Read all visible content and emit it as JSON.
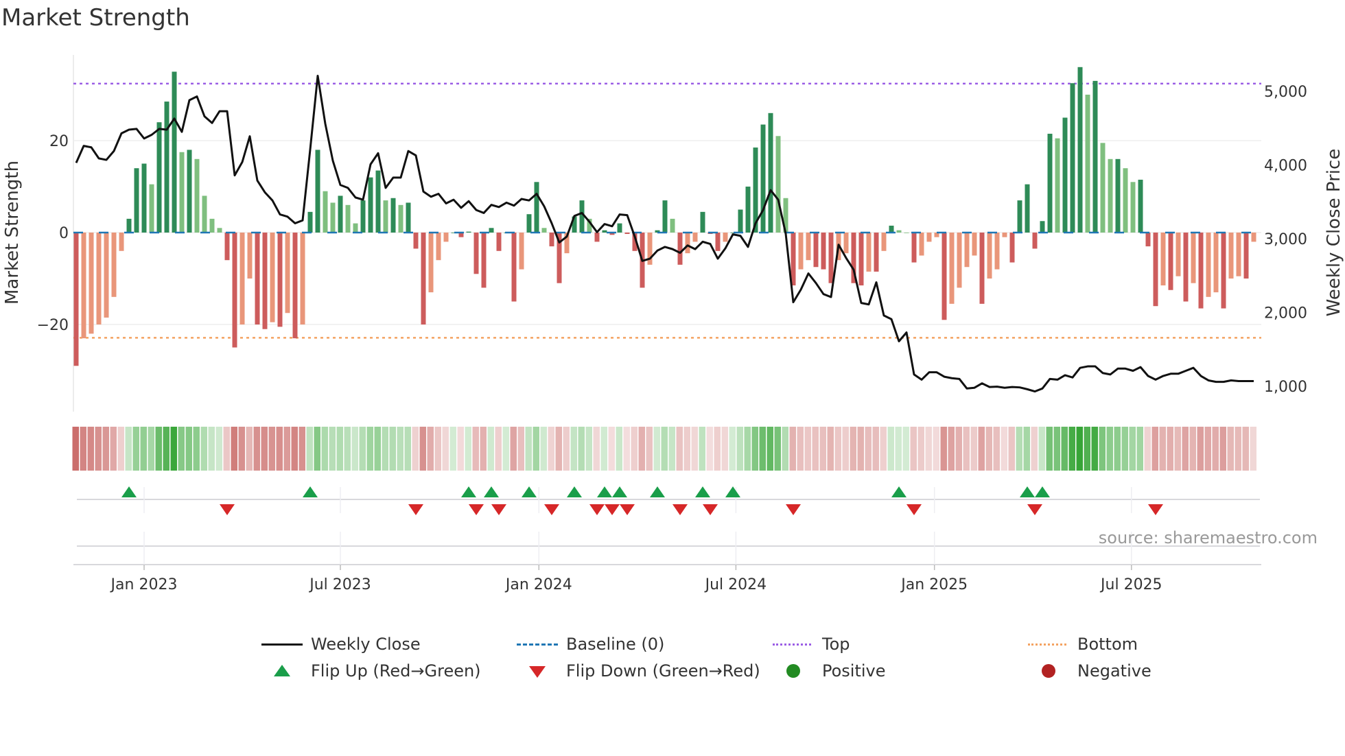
{
  "title": "Market Strength",
  "source": "source: sharemaestro.com",
  "chart_data": {
    "type": "bar",
    "title": "Market Strength",
    "ylabel": "Market Strength",
    "y2label": "Weekly Close Price",
    "ylim": [
      -38,
      38
    ],
    "y2lim": [
      770,
      5450
    ],
    "yticks": [
      {
        "v": 20,
        "label": "20"
      },
      {
        "v": 0,
        "label": "0"
      },
      {
        "v": -20,
        "label": "−20"
      }
    ],
    "y2ticks": [
      {
        "v": 5000,
        "label": "5,000"
      },
      {
        "v": 4000,
        "label": "4,000"
      },
      {
        "v": 3000,
        "label": "3,000"
      },
      {
        "v": 2000,
        "label": "2,000"
      },
      {
        "v": 1000,
        "label": "1,000"
      }
    ],
    "xticks": [
      {
        "week": 9,
        "label": "Jan 2023"
      },
      {
        "week": 35,
        "label": "Jul 2023"
      },
      {
        "week": 61.3,
        "label": "Jan 2024"
      },
      {
        "week": 87.4,
        "label": "Jul 2024"
      },
      {
        "week": 113.7,
        "label": "Jan 2025"
      },
      {
        "week": 139.8,
        "label": "Jul 2025"
      }
    ],
    "top_level": 32.4,
    "bottom_level": -22.9,
    "baseline": 0,
    "strength": [
      -29,
      -23,
      -22,
      -20,
      -18.5,
      -14,
      -4,
      3,
      14,
      15,
      10.5,
      24,
      28.5,
      35,
      17.5,
      18,
      16,
      8,
      3,
      1,
      -6,
      -25,
      -20,
      -10,
      -20,
      -21,
      -19.5,
      -20.5,
      -17.5,
      -23,
      -20,
      4.5,
      18,
      9,
      6.5,
      8,
      6,
      2,
      7,
      12,
      13.5,
      7,
      7.5,
      6,
      6.5,
      -3.5,
      -20,
      -13,
      -6,
      -2,
      0,
      -1,
      0.2,
      -9,
      -12,
      1,
      -4,
      0,
      -15,
      -8,
      4,
      11,
      1,
      -3,
      -11,
      -4.5,
      3.5,
      7,
      3,
      -2,
      0.5,
      -0.5,
      2,
      -0.3,
      -4,
      -12,
      -7,
      0.5,
      7,
      3,
      -7,
      -4.5,
      -2,
      4.5,
      -0.3,
      -4,
      -2,
      0,
      5,
      10,
      18.5,
      23.5,
      26,
      21,
      7.5,
      -11.5,
      -8,
      -6,
      -7.5,
      -8,
      -11,
      -6,
      -4.5,
      -11,
      -11.5,
      -8.5,
      -8.5,
      -4,
      1.5,
      0.5,
      0,
      -6.5,
      -5,
      -2,
      -1,
      -19,
      -15.5,
      -12,
      -7.5,
      -5,
      -15.5,
      -10,
      -8,
      -1,
      -6.5,
      7,
      10.5,
      -3.5,
      2.5,
      21.5,
      20.5,
      25,
      32.5,
      36,
      30,
      33,
      19.5,
      16,
      16,
      14,
      11,
      11.5,
      -3,
      -16,
      -11.5,
      -12.5,
      -9.5,
      -15,
      -11,
      -16.5,
      -14,
      -13,
      -16.5,
      -10,
      -9.5,
      -10,
      -2
    ],
    "weekly_close": [
      4020,
      4250,
      4230,
      4080,
      4060,
      4180,
      4420,
      4470,
      4480,
      4350,
      4400,
      4480,
      4470,
      4620,
      4440,
      4870,
      4920,
      4650,
      4560,
      4720,
      4720,
      3850,
      4030,
      4380,
      3780,
      3620,
      3510,
      3320,
      3290,
      3200,
      3240,
      4200,
      5200,
      4550,
      4050,
      3720,
      3680,
      3550,
      3520,
      4000,
      4150,
      3680,
      3820,
      3820,
      4180,
      4120,
      3630,
      3560,
      3600,
      3470,
      3520,
      3410,
      3500,
      3380,
      3340,
      3450,
      3420,
      3480,
      3440,
      3530,
      3510,
      3600,
      3430,
      3200,
      2940,
      3020,
      3300,
      3340,
      3220,
      3080,
      3190,
      3160,
      3320,
      3310,
      3020,
      2690,
      2720,
      2830,
      2880,
      2850,
      2800,
      2900,
      2850,
      2950,
      2920,
      2720,
      2860,
      3050,
      3030,
      2880,
      3200,
      3380,
      3650,
      3520,
      3060,
      2130,
      2300,
      2520,
      2390,
      2240,
      2200,
      2910,
      2730,
      2570,
      2120,
      2100,
      2400,
      1950,
      1900,
      1600,
      1720,
      1150,
      1080,
      1180,
      1180,
      1120,
      1100,
      1090,
      960,
      970,
      1030,
      980,
      985,
      970,
      980,
      975,
      950,
      920,
      960,
      1090,
      1080,
      1140,
      1110,
      1240,
      1260,
      1260,
      1170,
      1150,
      1230,
      1230,
      1200,
      1250,
      1130,
      1080,
      1130,
      1160,
      1160,
      1200,
      1240,
      1130,
      1070,
      1050,
      1050,
      1070,
      1060,
      1060,
      1060
    ],
    "flip_up_weeks": [
      7,
      31,
      52,
      55,
      60,
      66,
      70,
      72,
      77,
      83,
      87,
      109,
      126,
      128
    ],
    "flip_down_weeks": [
      20,
      45,
      53,
      56,
      63,
      69,
      71,
      73,
      80,
      84,
      95,
      111,
      127,
      143
    ],
    "colors": {
      "green_dark": "#2e8b57",
      "green_light": "#7fbf7f",
      "red_dark": "#cd5c5c",
      "red_light": "#e9967a",
      "line": "#111111",
      "baseline": "#1f77b4",
      "top": "#9b5de5",
      "bottom": "#f4a261",
      "flip_up": "#1a9e4a",
      "flip_down": "#d62728",
      "positive": "#228b22",
      "negative": "#b22222"
    },
    "legend": {
      "placement": "bottom",
      "weekly_close": "Weekly Close",
      "baseline": "Baseline (0)",
      "top": "Top",
      "bottom": "Bottom",
      "flip_up": "Flip Up (Red→Green)",
      "flip_down": "Flip Down (Green→Red)",
      "positive": "Positive",
      "negative": "Negative"
    }
  }
}
